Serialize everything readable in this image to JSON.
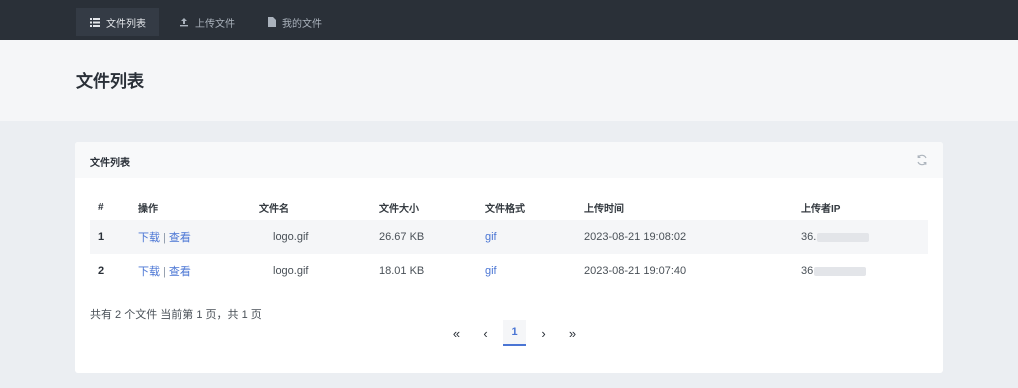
{
  "nav": {
    "items": [
      {
        "label": "文件列表",
        "icon": "list-icon",
        "active": true
      },
      {
        "label": "上传文件",
        "icon": "upload-icon",
        "active": false
      },
      {
        "label": "我的文件",
        "icon": "file-icon",
        "active": false
      }
    ]
  },
  "hero": {
    "title": "文件列表"
  },
  "card": {
    "title": "文件列表",
    "refresh_icon": "refresh-icon"
  },
  "table": {
    "headers": [
      "#",
      "操作",
      "文件名",
      "文件大小",
      "文件格式",
      "上传时间",
      "上传者IP"
    ],
    "action_download": "下载",
    "action_separator": "|",
    "action_view": "查看",
    "rows": [
      {
        "index": "1",
        "filename": "logo.gif",
        "size": "26.67 KB",
        "format": "gif",
        "time": "2023-08-21 19:08:02",
        "ip": "36."
      },
      {
        "index": "2",
        "filename": "logo.gif",
        "size": "18.01 KB",
        "format": "gif",
        "time": "2023-08-21 19:07:40",
        "ip": "36"
      }
    ]
  },
  "summary": "共有 2 个文件  当前第 1 页，共 1 页",
  "pagination": {
    "first": "«",
    "prev": "‹",
    "current": "1",
    "next": "›",
    "last": "»"
  },
  "colors": {
    "topbar": "#2a3038",
    "link": "#4a75d4",
    "background": "#ebeef2"
  }
}
